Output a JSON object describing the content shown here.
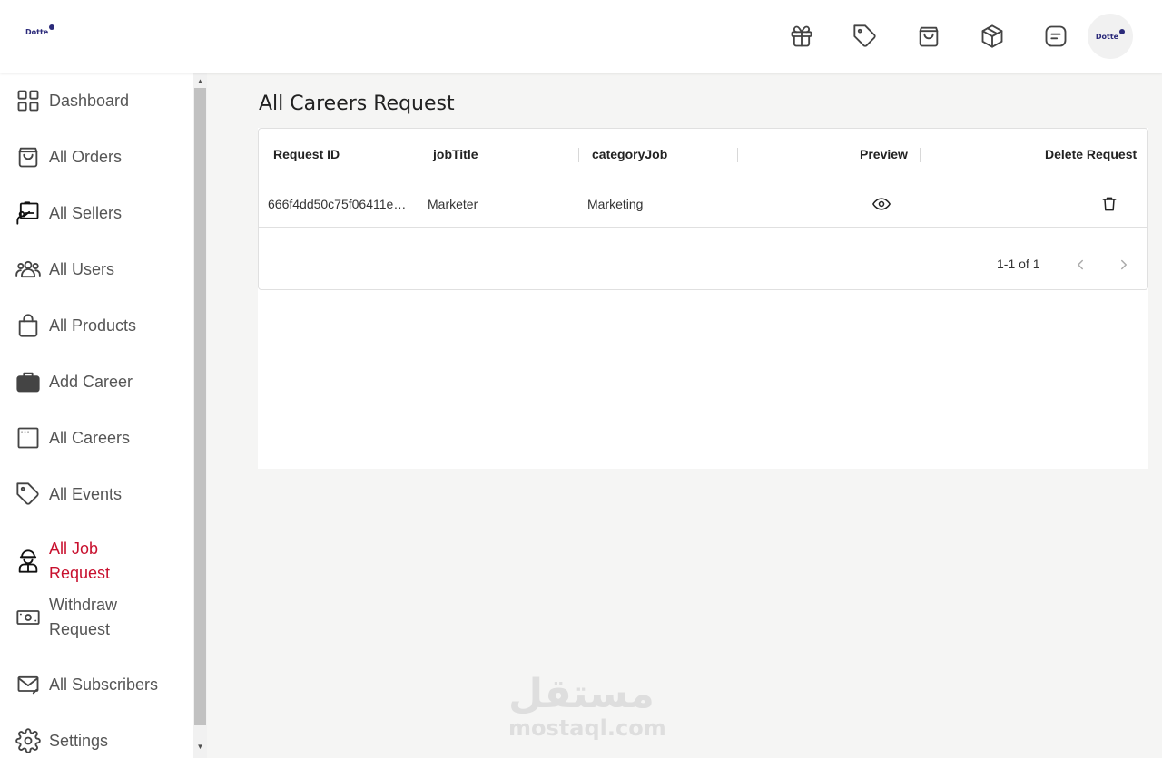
{
  "brand": {
    "logo_text": "Dotte",
    "avatar_text": "Dotte"
  },
  "header": {
    "icons": [
      "gift-icon",
      "tag-icon",
      "shopping-bag-icon",
      "box-icon",
      "note-icon"
    ]
  },
  "sidebar": {
    "items": [
      {
        "label": "Dashboard",
        "icon": "dashboard-icon"
      },
      {
        "label": "All Orders",
        "icon": "shopping-bag-icon"
      },
      {
        "label": "All Sellers",
        "icon": "seller-icon"
      },
      {
        "label": "All Users",
        "icon": "users-icon"
      },
      {
        "label": "All Products",
        "icon": "handbag-icon"
      },
      {
        "label": "Add Career",
        "icon": "briefcase-icon"
      },
      {
        "label": "All Careers",
        "icon": "window-icon"
      },
      {
        "label": "All Events",
        "icon": "tag-icon"
      },
      {
        "label": "All Job Request",
        "icon": "worker-icon",
        "active": true
      },
      {
        "label": "Withdraw Request",
        "icon": "cash-icon"
      },
      {
        "label": "All Subscribers",
        "icon": "mail-icon"
      },
      {
        "label": "Settings",
        "icon": "gear-icon"
      }
    ]
  },
  "main": {
    "title": "All Careers Request",
    "table": {
      "columns": [
        "Request ID",
        "jobTitle",
        "categoryJob",
        "Preview",
        "Delete Request"
      ],
      "rows": [
        {
          "request_id": "666f4dd50c75f06411e…",
          "job_title": "Marketer",
          "category_job": "Marketing"
        }
      ],
      "pagination": "1-1 of 1"
    }
  },
  "watermark": {
    "arabic": "مستقل",
    "latin": "mostaql.com"
  },
  "colors": {
    "active": "#c8102e",
    "brand": "#2b2a7a"
  }
}
